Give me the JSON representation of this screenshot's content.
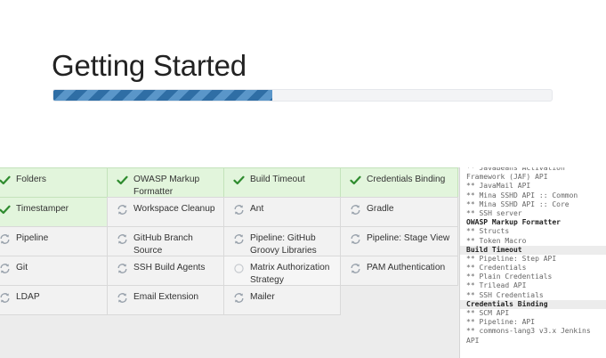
{
  "page": {
    "title": "Getting Started"
  },
  "progress": {
    "fraction": 0.44
  },
  "colors": {
    "success": "#2e8b2e",
    "pending": "#9aa3ad",
    "progress_dark": "#2f6ea5",
    "progress_light": "#5a96c9"
  },
  "plugins": [
    {
      "label": "Folders",
      "status": "success",
      "icon": "check-icon"
    },
    {
      "label": "OWASP Markup Formatter",
      "status": "success",
      "icon": "check-icon"
    },
    {
      "label": "Build Timeout",
      "status": "success",
      "icon": "check-icon"
    },
    {
      "label": "Credentials Binding",
      "status": "success",
      "icon": "check-icon"
    },
    {
      "label": "Timestamper",
      "status": "success",
      "icon": "check-icon"
    },
    {
      "label": "Workspace Cleanup",
      "status": "installing",
      "icon": "refresh-icon"
    },
    {
      "label": "Ant",
      "status": "installing",
      "icon": "refresh-icon"
    },
    {
      "label": "Gradle",
      "status": "installing",
      "icon": "refresh-icon"
    },
    {
      "label": "Pipeline",
      "status": "installing",
      "icon": "refresh-icon"
    },
    {
      "label": "GitHub Branch Source",
      "status": "installing",
      "icon": "refresh-icon"
    },
    {
      "label": "Pipeline: GitHub Groovy Libraries",
      "status": "installing",
      "icon": "refresh-icon"
    },
    {
      "label": "Pipeline: Stage View",
      "status": "installing",
      "icon": "refresh-icon"
    },
    {
      "label": "Git",
      "status": "installing",
      "icon": "refresh-icon"
    },
    {
      "label": "SSH Build Agents",
      "status": "installing",
      "icon": "refresh-icon"
    },
    {
      "label": "Matrix Authorization Strategy",
      "status": "pending",
      "icon": "circle-icon"
    },
    {
      "label": "PAM Authentication",
      "status": "installing",
      "icon": "refresh-icon"
    },
    {
      "label": "LDAP",
      "status": "installing",
      "icon": "refresh-icon"
    },
    {
      "label": "Email Extension",
      "status": "installing",
      "icon": "refresh-icon"
    },
    {
      "label": "Mailer",
      "status": "installing",
      "icon": "refresh-icon"
    }
  ],
  "log": [
    {
      "text": "** JavaBeans Activation",
      "type": "dep"
    },
    {
      "text": "Framework (JAF) API",
      "type": "dep"
    },
    {
      "text": "** JavaMail API",
      "type": "dep"
    },
    {
      "text": "** Mina SSHD API :: Common",
      "type": "dep"
    },
    {
      "text": "** Mina SSHD API :: Core",
      "type": "dep"
    },
    {
      "text": "** SSH server",
      "type": "dep"
    },
    {
      "text": "OWASP Markup Formatter",
      "type": "head"
    },
    {
      "text": "** Structs",
      "type": "dep"
    },
    {
      "text": "** Token Macro",
      "type": "dep"
    },
    {
      "text": "Build Timeout",
      "type": "head-shade"
    },
    {
      "text": "** Pipeline: Step API",
      "type": "dep"
    },
    {
      "text": "** Credentials",
      "type": "dep"
    },
    {
      "text": "** Plain Credentials",
      "type": "dep"
    },
    {
      "text": "** Trilead API",
      "type": "dep"
    },
    {
      "text": "** SSH Credentials",
      "type": "dep"
    },
    {
      "text": "Credentials Binding",
      "type": "head-shade"
    },
    {
      "text": "** SCM API",
      "type": "dep"
    },
    {
      "text": "** Pipeline: API",
      "type": "dep"
    },
    {
      "text": "** commons-lang3 v3.x Jenkins",
      "type": "dep"
    },
    {
      "text": "API",
      "type": "dep"
    }
  ]
}
